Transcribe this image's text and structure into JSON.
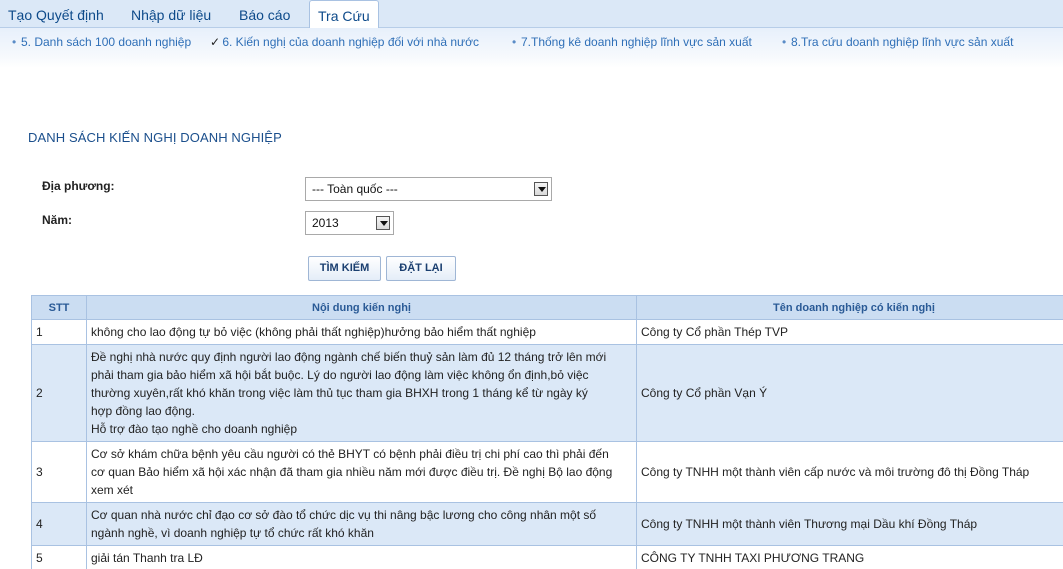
{
  "tabs": [
    {
      "label": "Tạo Quyết định"
    },
    {
      "label": "Nhập dữ liệu"
    },
    {
      "label": "Báo cáo"
    },
    {
      "label": "Tra Cứu"
    }
  ],
  "subnav": [
    {
      "label": "5. Danh sách 100 doanh nghiệp",
      "marker": "•"
    },
    {
      "label": "6. Kiến nghị của doanh nghiệp đối với nhà nước",
      "marker": "✓"
    },
    {
      "label": "7.Thống kê doanh nghiệp lĩnh vực sản xuất",
      "marker": "•"
    },
    {
      "label": "8.Tra cứu doanh nghiệp lĩnh vực sản xuất",
      "marker": "•"
    }
  ],
  "page_title": "DANH SÁCH KIẾN NGHỊ DOANH NGHIỆP",
  "filters": {
    "locality_label": "Địa phương:",
    "locality_value": "--- Toàn quốc ---",
    "year_label": "Năm:",
    "year_value": "2013"
  },
  "buttons": {
    "search": "TÌM KIẾM",
    "reset": "ĐẶT LẠI"
  },
  "table": {
    "headers": [
      "STT",
      "Nội dung kiến nghị",
      "Tên doanh nghiệp có kiến nghị"
    ],
    "rows": [
      {
        "stt": "1",
        "lines": [
          "không cho lao động tự bỏ việc (không phải thất nghiệp)hưởng bảo hiểm thất nghiệp"
        ],
        "company": "Công ty Cổ phần Thép TVP"
      },
      {
        "stt": "2",
        "lines": [
          "Đề nghị nhà nước quy định người lao động ngành chế biến thuỷ sản làm đủ 12 tháng trở lên mới",
          "phải tham gia bảo hiểm xã hội bắt buộc. Lý do người lao động làm việc không ổn định,bỏ việc",
          "thường xuyên,rất khó khăn trong việc làm thủ tục tham gia BHXH trong 1 tháng kể từ ngày ký",
          "hợp đồng lao động.",
          "Hỗ trợ đào tạo nghề cho doanh nghiệp"
        ],
        "company": "Công ty Cổ phần Vạn Ý"
      },
      {
        "stt": "3",
        "lines": [
          "Cơ sở khám chữa bệnh yêu cầu người có thẻ BHYT có bệnh phải điều trị chi phí cao thì phải đến",
          "cơ quan Bảo hiểm xã hội xác nhận đã tham gia nhiều năm mới được điều trị. Đề nghị Bộ lao động",
          "xem xét"
        ],
        "company": "Công ty TNHH một thành viên cấp nước và môi trường đô thị Đồng Tháp"
      },
      {
        "stt": "4",
        "lines": [
          "Cơ quan nhà nước chỉ đạo cơ sở đào tổ chức dịc vụ thi nâng bậc lương cho công nhân một số",
          "ngành nghề, vì doanh nghiệp tự tổ chức rất khó khăn"
        ],
        "company": "Công ty TNHH một thành viên Thương mại Dầu khí Đồng Tháp"
      },
      {
        "stt": "5",
        "lines": [
          "giải tán Thanh tra LĐ"
        ],
        "company": "CÔNG TY TNHH TAXI PHƯƠNG TRANG"
      }
    ]
  }
}
